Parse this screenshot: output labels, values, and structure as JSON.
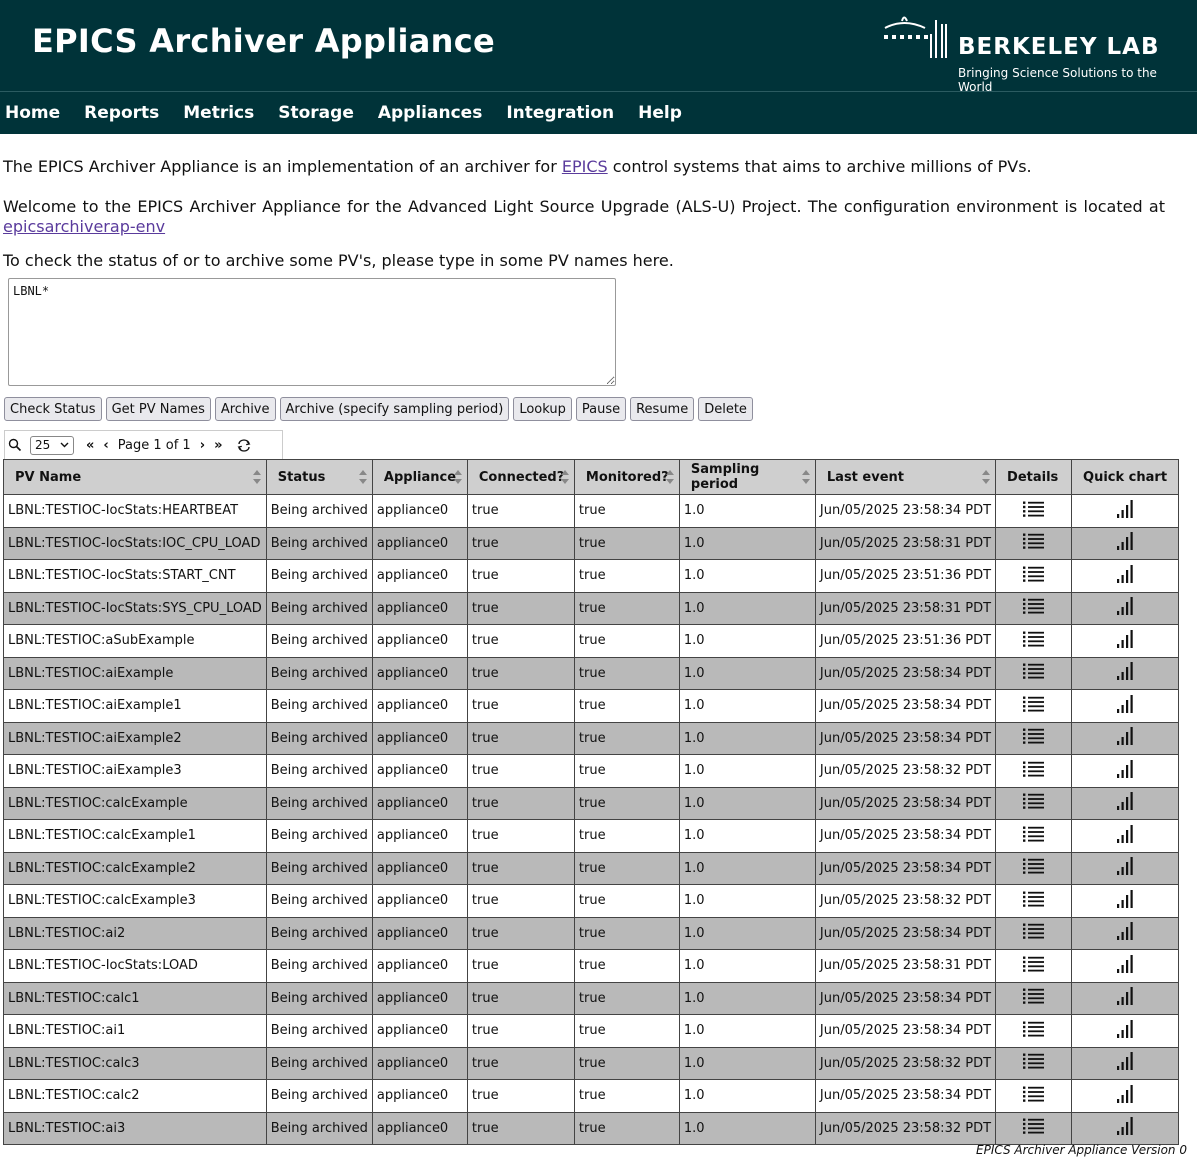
{
  "header": {
    "app_title": "EPICS Archiver Appliance",
    "lab_name": "BERKELEY LAB",
    "lab_tagline": "Bringing Science Solutions to the World"
  },
  "nav": [
    "Home",
    "Reports",
    "Metrics",
    "Storage",
    "Appliances",
    "Integration",
    "Help"
  ],
  "intro": {
    "p1_before": "The EPICS Archiver Appliance is an implementation of an archiver for ",
    "p1_link": "EPICS",
    "p1_after": " control systems that aims to archive millions of PVs.",
    "p2_text": "Welcome to the EPICS Archiver Appliance for the Advanced Light Source Upgrade (ALS-U) Project. The configuration environment is located at ",
    "p2_link": "epicsarchiverap-env",
    "p3": "To check the status of or to archive some PV's, please type in some PV names here."
  },
  "pv_input_value": "LBNL*",
  "buttons": [
    "Check Status",
    "Get PV Names",
    "Archive",
    "Archive (specify sampling period)",
    "Lookup",
    "Pause",
    "Resume",
    "Delete"
  ],
  "toolbar": {
    "page_size": "25",
    "page_label": "Page 1 of 1",
    "first": "«",
    "prev": "‹",
    "next": "›",
    "last": "»"
  },
  "table": {
    "columns": [
      "PV Name",
      "Status",
      "Appliance",
      "Connected?",
      "Monitored?",
      "Sampling period",
      "Last event",
      "Details",
      "Quick chart"
    ],
    "rows": [
      [
        "LBNL:TESTIOC-IocStats:HEARTBEAT",
        "Being archived",
        "appliance0",
        "true",
        "true",
        "1.0",
        "Jun/05/2025 23:58:34 PDT"
      ],
      [
        "LBNL:TESTIOC-IocStats:IOC_CPU_LOAD",
        "Being archived",
        "appliance0",
        "true",
        "true",
        "1.0",
        "Jun/05/2025 23:58:31 PDT"
      ],
      [
        "LBNL:TESTIOC-IocStats:START_CNT",
        "Being archived",
        "appliance0",
        "true",
        "true",
        "1.0",
        "Jun/05/2025 23:51:36 PDT"
      ],
      [
        "LBNL:TESTIOC-IocStats:SYS_CPU_LOAD",
        "Being archived",
        "appliance0",
        "true",
        "true",
        "1.0",
        "Jun/05/2025 23:58:31 PDT"
      ],
      [
        "LBNL:TESTIOC:aSubExample",
        "Being archived",
        "appliance0",
        "true",
        "true",
        "1.0",
        "Jun/05/2025 23:51:36 PDT"
      ],
      [
        "LBNL:TESTIOC:aiExample",
        "Being archived",
        "appliance0",
        "true",
        "true",
        "1.0",
        "Jun/05/2025 23:58:34 PDT"
      ],
      [
        "LBNL:TESTIOC:aiExample1",
        "Being archived",
        "appliance0",
        "true",
        "true",
        "1.0",
        "Jun/05/2025 23:58:34 PDT"
      ],
      [
        "LBNL:TESTIOC:aiExample2",
        "Being archived",
        "appliance0",
        "true",
        "true",
        "1.0",
        "Jun/05/2025 23:58:34 PDT"
      ],
      [
        "LBNL:TESTIOC:aiExample3",
        "Being archived",
        "appliance0",
        "true",
        "true",
        "1.0",
        "Jun/05/2025 23:58:32 PDT"
      ],
      [
        "LBNL:TESTIOC:calcExample",
        "Being archived",
        "appliance0",
        "true",
        "true",
        "1.0",
        "Jun/05/2025 23:58:34 PDT"
      ],
      [
        "LBNL:TESTIOC:calcExample1",
        "Being archived",
        "appliance0",
        "true",
        "true",
        "1.0",
        "Jun/05/2025 23:58:34 PDT"
      ],
      [
        "LBNL:TESTIOC:calcExample2",
        "Being archived",
        "appliance0",
        "true",
        "true",
        "1.0",
        "Jun/05/2025 23:58:34 PDT"
      ],
      [
        "LBNL:TESTIOC:calcExample3",
        "Being archived",
        "appliance0",
        "true",
        "true",
        "1.0",
        "Jun/05/2025 23:58:32 PDT"
      ],
      [
        "LBNL:TESTIOC:ai2",
        "Being archived",
        "appliance0",
        "true",
        "true",
        "1.0",
        "Jun/05/2025 23:58:34 PDT"
      ],
      [
        "LBNL:TESTIOC-IocStats:LOAD",
        "Being archived",
        "appliance0",
        "true",
        "true",
        "1.0",
        "Jun/05/2025 23:58:31 PDT"
      ],
      [
        "LBNL:TESTIOC:calc1",
        "Being archived",
        "appliance0",
        "true",
        "true",
        "1.0",
        "Jun/05/2025 23:58:34 PDT"
      ],
      [
        "LBNL:TESTIOC:ai1",
        "Being archived",
        "appliance0",
        "true",
        "true",
        "1.0",
        "Jun/05/2025 23:58:34 PDT"
      ],
      [
        "LBNL:TESTIOC:calc3",
        "Being archived",
        "appliance0",
        "true",
        "true",
        "1.0",
        "Jun/05/2025 23:58:32 PDT"
      ],
      [
        "LBNL:TESTIOC:calc2",
        "Being archived",
        "appliance0",
        "true",
        "true",
        "1.0",
        "Jun/05/2025 23:58:34 PDT"
      ],
      [
        "LBNL:TESTIOC:ai3",
        "Being archived",
        "appliance0",
        "true",
        "true",
        "1.0",
        "Jun/05/2025 23:58:32 PDT"
      ]
    ]
  },
  "footer_version": "EPICS Archiver Appliance Version 0",
  "icons": {
    "details": "list-icon",
    "quick_chart": "bar-chart-icon",
    "search": "search-icon",
    "refresh": "refresh-icon"
  },
  "colors": {
    "header_bg": "#003339",
    "row_alt": "#b9b9b9",
    "header_row": "#cfcfcf",
    "link": "#5a3b9c"
  }
}
